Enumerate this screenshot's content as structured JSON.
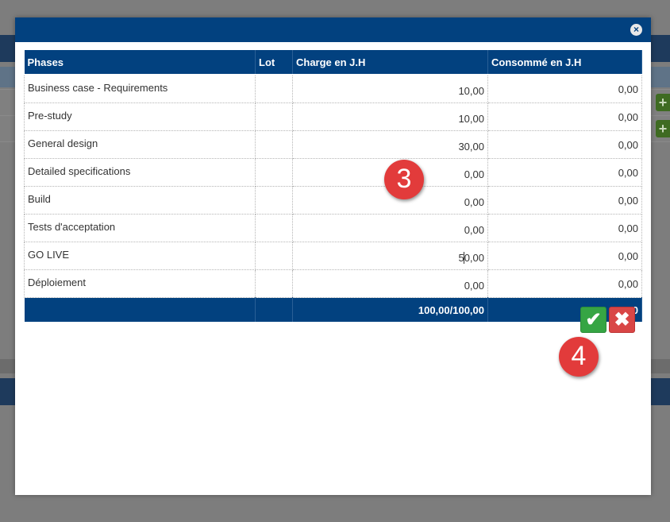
{
  "background": {
    "plus_icon": "plus-icon"
  },
  "modal": {
    "close_icon": "close-icon",
    "table": {
      "headers": [
        "Phases",
        "Lot",
        "Charge en J.H",
        "Consommé en J.H"
      ],
      "rows": [
        {
          "phase": "Business case - Requirements",
          "lot": "",
          "charge": "10,00",
          "consomme": "0,00"
        },
        {
          "phase": "Pre-study",
          "lot": "",
          "charge": "10,00",
          "consomme": "0,00"
        },
        {
          "phase": "General design",
          "lot": "",
          "charge": "30,00",
          "consomme": "0,00"
        },
        {
          "phase": "Detailed specifications",
          "lot": "",
          "charge": "0,00",
          "consomme": "0,00"
        },
        {
          "phase": "Build",
          "lot": "",
          "charge": "0,00",
          "consomme": "0,00"
        },
        {
          "phase": "Tests d'acceptation",
          "lot": "",
          "charge": "0,00",
          "consomme": "0,00"
        },
        {
          "phase": "GO LIVE",
          "lot": "",
          "charge_before_caret": "5",
          "charge_after_caret": "0,00",
          "consomme": "0,00"
        },
        {
          "phase": "Déploiement",
          "lot": "",
          "charge": "0,00",
          "consomme": "0,00"
        }
      ],
      "total": {
        "charge": "100,00/100,00",
        "consomme": "0,00"
      }
    },
    "buttons": {
      "confirm_icon": "checkmark-icon",
      "cancel_icon": "cross-icon",
      "confirm_glyph": "✔",
      "cancel_glyph": "✖"
    },
    "annotations": {
      "step3": "3",
      "step4": "4"
    }
  }
}
